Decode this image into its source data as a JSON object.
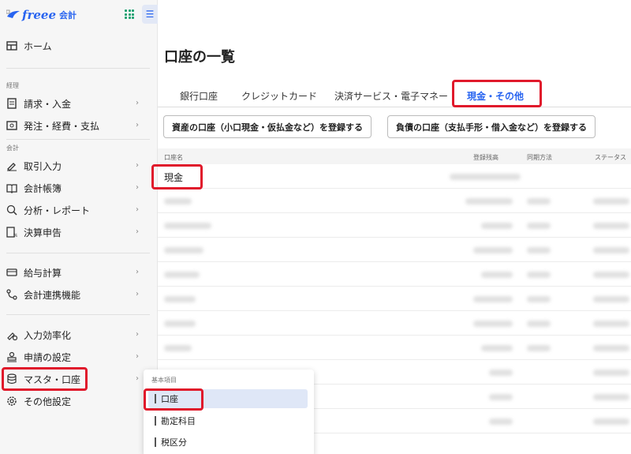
{
  "brand": {
    "name": "freee",
    "suffix": "会計",
    "primary": "#2864f0",
    "highlight": "#e0192b"
  },
  "sidebar": {
    "home": "ホーム",
    "sections": {
      "accounting": "経理",
      "books": "会計"
    },
    "items": [
      {
        "label": "請求・入金",
        "icon": "invoice-icon"
      },
      {
        "label": "発注・経費・支払",
        "icon": "expense-icon"
      },
      {
        "label": "取引入力",
        "icon": "pen-icon"
      },
      {
        "label": "会計帳簿",
        "icon": "book-icon"
      },
      {
        "label": "分析・レポート",
        "icon": "analysis-icon"
      },
      {
        "label": "決算申告",
        "icon": "tax-return-icon"
      },
      {
        "label": "給与計算",
        "icon": "payroll-icon"
      },
      {
        "label": "会計連携機能",
        "icon": "link-icon"
      },
      {
        "label": "入力効率化",
        "icon": "efficiency-icon"
      },
      {
        "label": "申請の設定",
        "icon": "approval-icon"
      },
      {
        "label": "マスタ・口座",
        "icon": "database-icon"
      },
      {
        "label": "その他設定",
        "icon": "gear-icon"
      }
    ]
  },
  "submenu": {
    "label": "基本項目",
    "items": [
      "口座",
      "勘定科目",
      "税区分"
    ]
  },
  "main": {
    "title": "口座の一覧",
    "tabs": [
      "銀行口座",
      "クレジットカード",
      "決済サービス・電子マネー",
      "現金・その他"
    ],
    "buttons": {
      "asset": "資産の口座（小口現金・仮払金など）を登録する",
      "liability": "負債の口座（支払手形・借入金など）を登録する"
    },
    "table": {
      "headers": [
        "口座名",
        "登録残高",
        "同期方法",
        "ステータス"
      ],
      "first_row": "現金"
    }
  }
}
